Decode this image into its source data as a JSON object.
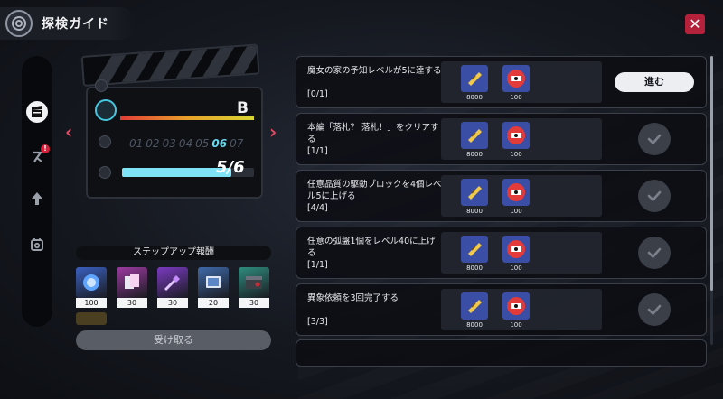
{
  "header": {
    "title": "探検ガイド",
    "title_icon": "spiral-emblem-icon"
  },
  "close": {
    "icon": "close-x-icon",
    "label": "✕"
  },
  "side_nav": [
    {
      "icon": "clapperboard-icon",
      "active": true
    },
    {
      "icon": "slash-claw-icon",
      "active": false,
      "badge": "!"
    },
    {
      "icon": "upgrade-arrow-icon",
      "active": false
    },
    {
      "icon": "bag-icon",
      "active": false
    }
  ],
  "board": {
    "grade": "B",
    "days": [
      "01",
      "02",
      "03",
      "04",
      "05",
      "06",
      "07"
    ],
    "current_day_index": 5,
    "progress_text": "5/6",
    "progress_fraction": 0.83
  },
  "step_rewards": {
    "title": "ステップアップ報酬",
    "items": [
      {
        "icon": "blue-orb-icon",
        "count": "100",
        "color": "#3a5fbf"
      },
      {
        "icon": "cards-icon",
        "count": "30",
        "color": "#9c3aa0"
      },
      {
        "icon": "crystal-wand-icon",
        "count": "30",
        "color": "#7a3ac0"
      },
      {
        "icon": "tablet-device-icon",
        "count": "20",
        "color": "#3f69a8"
      },
      {
        "icon": "chest-box-icon",
        "count": "30",
        "color": "#2f8c7e"
      }
    ],
    "claim_label": "受け取る"
  },
  "quests": [
    {
      "text": "魔女の家の予知レベルが5に達する",
      "progress": "[0/1]",
      "action": "go",
      "action_label": "進む",
      "rewards": [
        {
          "icon": "gold-ticket-icon",
          "count": "8000"
        },
        {
          "icon": "red-coupon-icon",
          "count": "100"
        }
      ]
    },
    {
      "text": "本編「落札？ 落札！」をクリアする",
      "progress": "[1/1]",
      "action": "done",
      "rewards": [
        {
          "icon": "gold-ticket-icon",
          "count": "8000"
        },
        {
          "icon": "red-coupon-icon",
          "count": "100"
        }
      ]
    },
    {
      "text": "任意品質の駆動ブロックを4個レベル5に上げる",
      "progress": "[4/4]",
      "action": "done",
      "rewards": [
        {
          "icon": "gold-ticket-icon",
          "count": "8000"
        },
        {
          "icon": "red-coupon-icon",
          "count": "100"
        }
      ]
    },
    {
      "text": "任意の弧盤1個をレベル40に上げる",
      "progress": "[1/1]",
      "action": "done",
      "rewards": [
        {
          "icon": "gold-ticket-icon",
          "count": "8000"
        },
        {
          "icon": "red-coupon-icon",
          "count": "100"
        }
      ]
    },
    {
      "text": "異象依頼を3回完了する",
      "progress": "[3/3]",
      "action": "done",
      "rewards": [
        {
          "icon": "gold-ticket-icon",
          "count": "8000"
        },
        {
          "icon": "red-coupon-icon",
          "count": "100"
        }
      ]
    }
  ],
  "colors": {
    "accent_red": "#b3213a",
    "progress_cyan": "#7fe3f6",
    "arrow_pink": "#e14a63"
  }
}
